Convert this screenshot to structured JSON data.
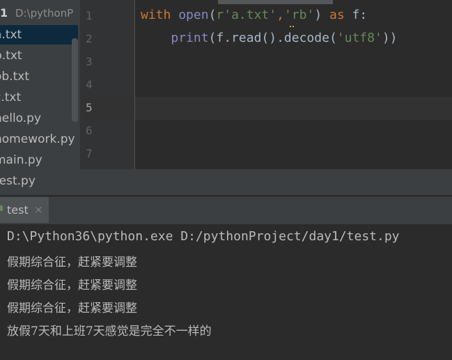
{
  "project": {
    "header_prefix": "1",
    "header_path": "D:\\pythonP",
    "files": [
      "a.txt",
      "b.txt",
      "ob.txt",
      "c.txt",
      "hello.py",
      "homework.py",
      "main.py",
      "test.py"
    ],
    "selected_file": "a.txt"
  },
  "editor": {
    "line_numbers": [
      "1",
      "2",
      "3",
      "4",
      "5",
      "6",
      "7"
    ],
    "current_line": "5",
    "code": {
      "line1": {
        "kw_with": "with",
        "fn_open": "open",
        "p1": "(",
        "prefix_r": "r",
        "str_path": "'a.txt'",
        "comma": ",",
        "str_mode": "'rb'",
        "p2": ")",
        "kw_as": "as",
        "var": "f:"
      },
      "line2": {
        "fn_print": "print",
        "mid": "(f.read().decode(",
        "str_enc": "'utf8'",
        "end": "))"
      }
    }
  },
  "run": {
    "tab_label": "test",
    "close_glyph": "×"
  },
  "console": {
    "lines": [
      "D:\\Python36\\python.exe D:/pythonProject/day1/test.py",
      "假期综合征，赶紧要调整",
      "假期综合征，赶紧要调整",
      "假期综合征，赶紧要调整",
      "放假7天和上班7天感觉是完全不一样的"
    ]
  },
  "colors": {
    "keyword": "#cc7832",
    "builtin": "#8888c6",
    "string": "#6a8759",
    "text": "#a9b7c6",
    "selection": "#0d293e"
  }
}
